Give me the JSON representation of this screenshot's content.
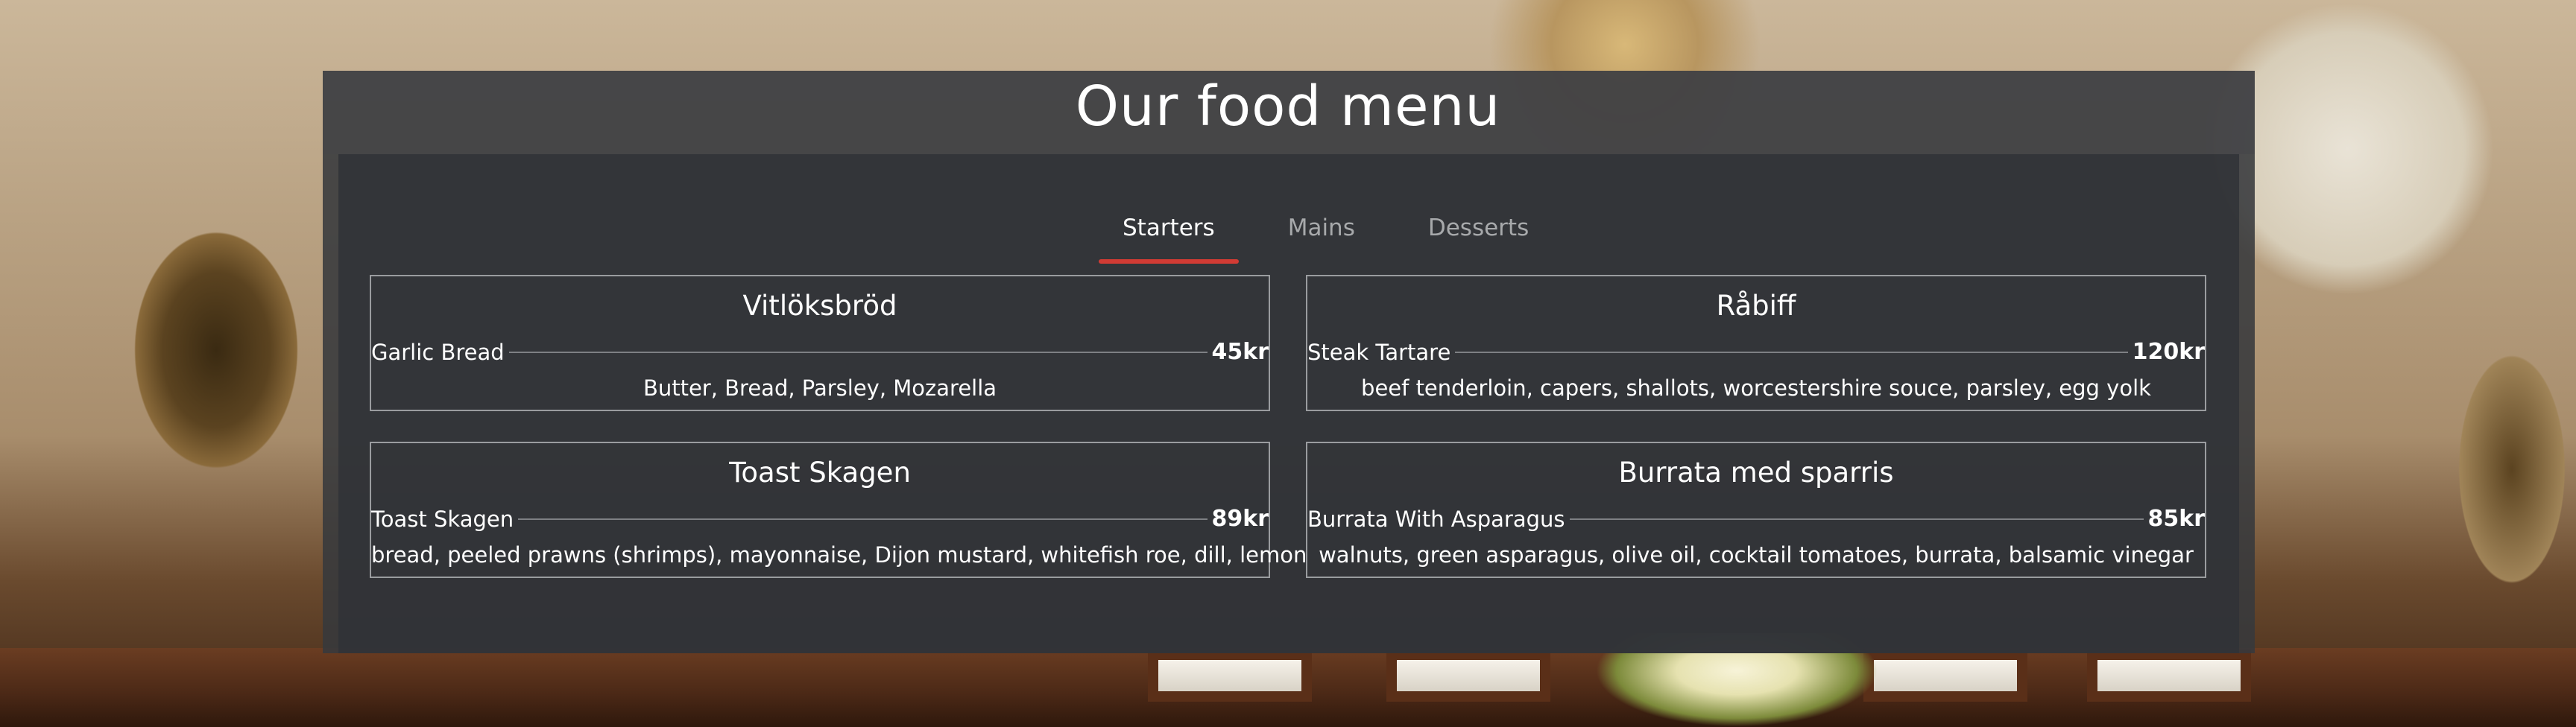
{
  "page": {
    "title": "Our food menu"
  },
  "tabs": [
    {
      "label": "Starters",
      "active": true
    },
    {
      "label": "Mains",
      "active": false
    },
    {
      "label": "Desserts",
      "active": false
    }
  ],
  "accent_color": "#d23b34",
  "items": [
    {
      "name": "Vitlöksbröd",
      "english": "Garlic Bread",
      "price": "45kr",
      "description": "Butter, Bread, Parsley, Mozarella"
    },
    {
      "name": "Råbiff",
      "english": "Steak Tartare",
      "price": "120kr",
      "description": "beef tenderloin, capers, shallots, worcestershire souce, parsley, egg yolk"
    },
    {
      "name": "Toast Skagen",
      "english": "Toast Skagen",
      "price": "89kr",
      "description": "bread, peeled prawns (shrimps), mayonnaise, Dijon mustard, whitefish roe, dill, lemon"
    },
    {
      "name": "Burrata med sparris",
      "english": "Burrata With Asparagus",
      "price": "85kr",
      "description": "walnuts, green asparagus, olive oil, cocktail tomatoes, burrata, balsamic vinegar"
    }
  ]
}
